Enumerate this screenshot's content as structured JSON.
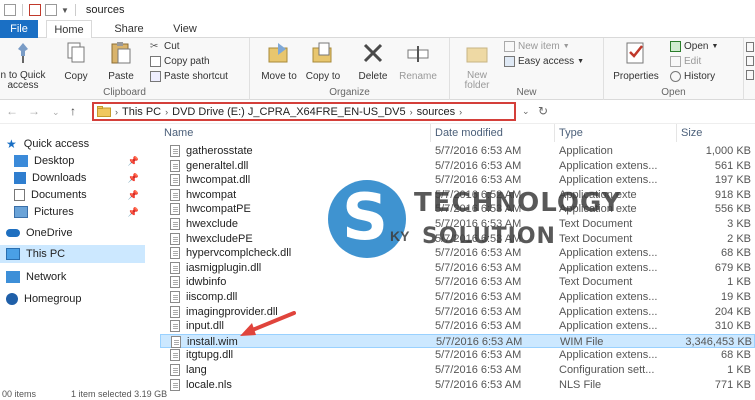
{
  "window": {
    "title": "sources"
  },
  "tabs": [
    {
      "label": "File"
    },
    {
      "label": "Home"
    },
    {
      "label": "Share"
    },
    {
      "label": "View"
    }
  ],
  "ribbon": {
    "clipboard": {
      "label": "Clipboard",
      "pin_quick_access": "n to Quick access",
      "copy": "Copy",
      "paste": "Paste",
      "cut": "Cut",
      "copy_path": "Copy path",
      "paste_shortcut": "Paste shortcut"
    },
    "organize": {
      "label": "Organize",
      "move_to": "Move to",
      "copy_to": "Copy to",
      "delete": "Delete",
      "rename": "Rename"
    },
    "new": {
      "label": "New",
      "new_folder": "New folder",
      "new_item": "New item",
      "easy_access": "Easy access"
    },
    "open": {
      "label": "Open",
      "properties": "Properties",
      "open": "Open",
      "edit": "Edit",
      "history": "History"
    }
  },
  "address": {
    "crumbs": [
      "This PC",
      "DVD Drive (E:) J_CPRA_X64FRE_EN-US_DV5",
      "sources"
    ]
  },
  "navpane": {
    "items": [
      {
        "label": "Quick access",
        "pinned": false
      },
      {
        "label": "Desktop",
        "pinned": true
      },
      {
        "label": "Downloads",
        "pinned": true
      },
      {
        "label": "Documents",
        "pinned": true
      },
      {
        "label": "Pictures",
        "pinned": true
      },
      {
        "label": "OneDrive",
        "pinned": false
      },
      {
        "label": "This PC",
        "pinned": false
      },
      {
        "label": "Network",
        "pinned": false
      },
      {
        "label": "Homegroup",
        "pinned": false
      }
    ],
    "pin_glyph": "📌"
  },
  "columns": {
    "name": "Name",
    "date": "Date modified",
    "type": "Type",
    "size": "Size"
  },
  "files": [
    {
      "name": "gatherosstate",
      "date": "5/7/2016 6:53 AM",
      "type": "Application",
      "size": "1,000 KB"
    },
    {
      "name": "generaltel.dll",
      "date": "5/7/2016 6:53 AM",
      "type": "Application extens...",
      "size": "561 KB"
    },
    {
      "name": "hwcompat.dll",
      "date": "5/7/2016 6:53 AM",
      "type": "Application extens...",
      "size": "197 KB"
    },
    {
      "name": "hwcompat",
      "date": "5/7/2016 6:52 AM",
      "type": "Application exte",
      "size": "918 KB"
    },
    {
      "name": "hwcompatPE",
      "date": "5/7/2016 6:53 AM",
      "type": "Application exte",
      "size": "556 KB"
    },
    {
      "name": "hwexclude",
      "date": "5/7/2016 6:53 AM",
      "type": "Text Document",
      "size": "3 KB"
    },
    {
      "name": "hwexcludePE",
      "date": "5/7/2016 6:53 AM",
      "type": "Text Document",
      "size": "2 KB"
    },
    {
      "name": "hypervcomplcheck.dll",
      "date": "5/7/2016 6:53 AM",
      "type": "Application extens...",
      "size": "68 KB"
    },
    {
      "name": "iasmigplugin.dll",
      "date": "5/7/2016 6:53 AM",
      "type": "Application extens...",
      "size": "679 KB"
    },
    {
      "name": "idwbinfo",
      "date": "5/7/2016 6:53 AM",
      "type": "Text Document",
      "size": "1 KB"
    },
    {
      "name": "iiscomp.dll",
      "date": "5/7/2016 6:53 AM",
      "type": "Application extens...",
      "size": "19 KB"
    },
    {
      "name": "imagingprovider.dll",
      "date": "5/7/2016 6:53 AM",
      "type": "Application extens...",
      "size": "204 KB"
    },
    {
      "name": "input.dll",
      "date": "5/7/2016 6:53 AM",
      "type": "Application extens...",
      "size": "310 KB"
    },
    {
      "name": "install.wim",
      "date": "5/7/2016 6:53 AM",
      "type": "WIM File",
      "size": "3,346,453 KB",
      "selected": true
    },
    {
      "name": "itgtupg.dll",
      "date": "5/7/2016 6:53 AM",
      "type": "Application extens...",
      "size": "68 KB"
    },
    {
      "name": "lang",
      "date": "5/7/2016 6:53 AM",
      "type": "Configuration sett...",
      "size": "1 KB"
    },
    {
      "name": "locale.nls",
      "date": "5/7/2016 6:53 AM",
      "type": "NLS File",
      "size": "771 KB"
    }
  ],
  "status": {
    "items": "00 items",
    "selected": "1 item selected  3.19 GB"
  },
  "watermark": {
    "s": "S",
    "technology": "TECHNOLOGY",
    "ky": "KY",
    "solution": "SOLUTION"
  },
  "colors": {
    "accent": "#1a6fc4",
    "selection": "#cce8ff",
    "highlight_box": "#d43f3a",
    "arrow": "#e0443c"
  }
}
